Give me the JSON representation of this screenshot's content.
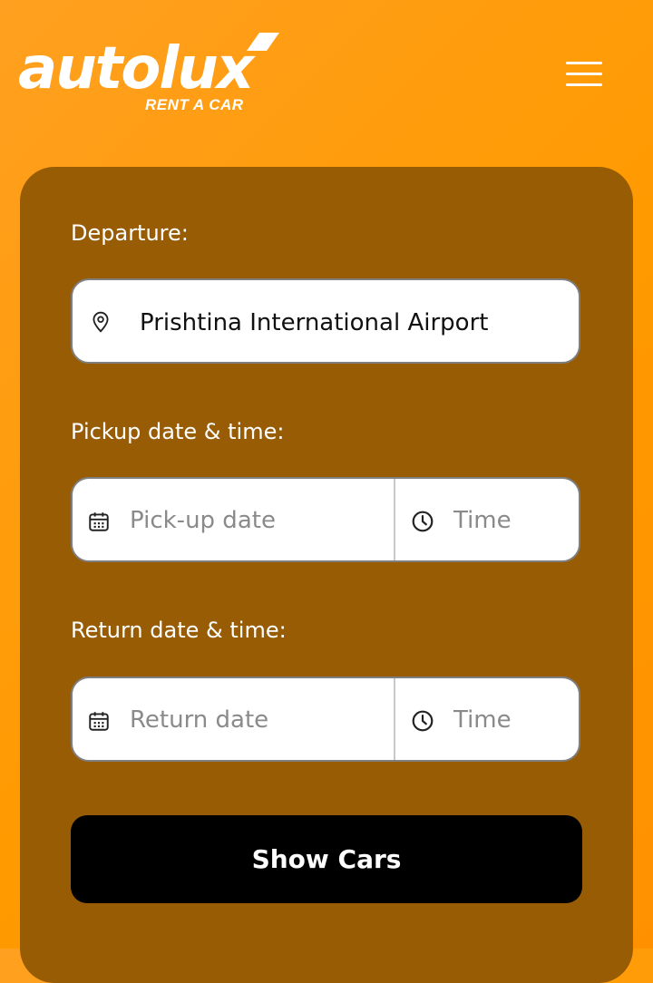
{
  "brand": {
    "name": "autolux",
    "tagline": "RENT A CAR"
  },
  "header": {
    "menu_icon": "hamburger-menu-icon"
  },
  "form": {
    "departure": {
      "label": "Departure:",
      "value": "Prishtina International Airport",
      "icon": "location-pin-icon"
    },
    "pickup": {
      "label": "Pickup date & time:",
      "date_placeholder": "Pick-up date",
      "time_placeholder": "Time",
      "date_icon": "calendar-icon",
      "time_icon": "clock-icon"
    },
    "return": {
      "label": "Return date & time:",
      "date_placeholder": "Return date",
      "time_placeholder": "Time",
      "date_icon": "calendar-icon",
      "time_icon": "clock-icon"
    },
    "submit_label": "Show Cars"
  },
  "colors": {
    "page_background": "#ff9a00",
    "card_background": "#985c04",
    "button_background": "#000000"
  }
}
